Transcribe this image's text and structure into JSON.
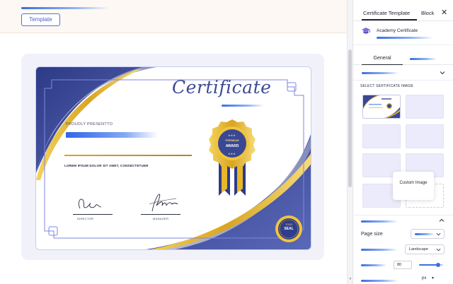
{
  "editor": {
    "template_button": "Template"
  },
  "certificate": {
    "title": "Certificate",
    "proudly": "PROUDLY PRESENTTO",
    "lorem": "LOREM IPSUM DOLOR SIT AMET, CONSECTETUER",
    "director": "DIRECTOR",
    "manager": "MANAGER",
    "award_line1": "PREMIUM",
    "award_line2": "AWARD",
    "seal_line1": "YOUR",
    "seal_line2": "SEAL"
  },
  "panel": {
    "tabs": [
      {
        "label": "Certificate Template"
      },
      {
        "label": "Block"
      }
    ],
    "close_icon": "close-icon",
    "block_icon": "graduation-cap-icon",
    "block_name": "Academy Certificate",
    "subtabs": [
      {
        "label": "General"
      }
    ],
    "select_label": "SELECT  SERTIFICATE IMAGE",
    "custom_image": "Custom Image",
    "page_size_label": "Page size",
    "orientation_value": "Landscape",
    "size_value": "80",
    "size_slider_value": 0.8,
    "unit_value": "px"
  },
  "colors": {
    "accent_blue": "#3b6fe0",
    "certificate_navy": "#3d4a93",
    "gold": "#d9a521"
  }
}
